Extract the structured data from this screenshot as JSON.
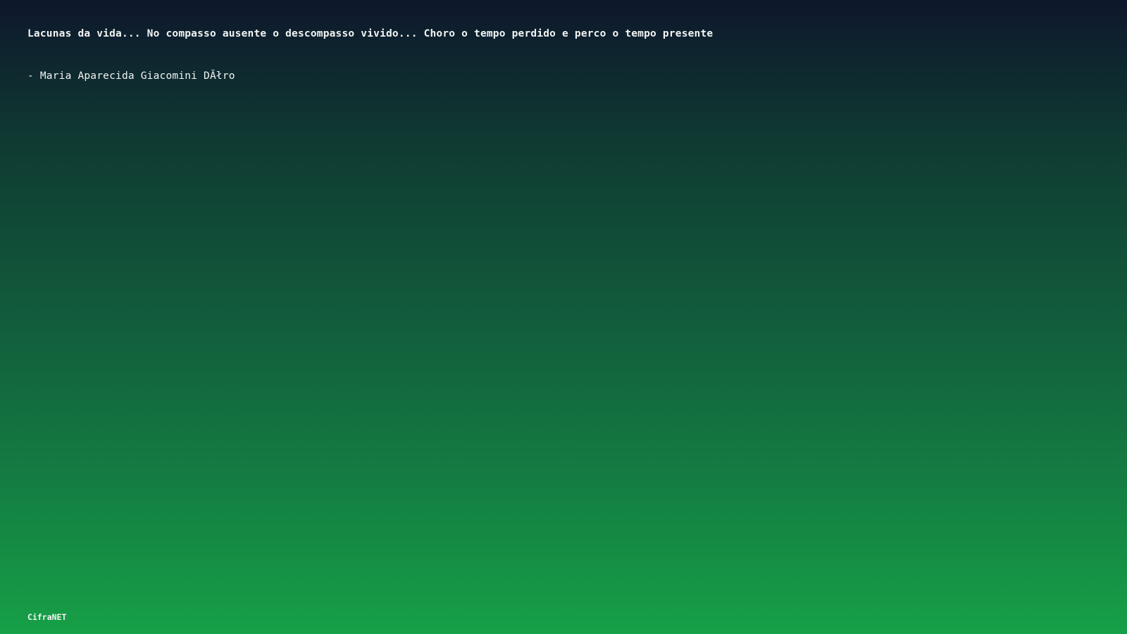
{
  "quote": {
    "text": "Lacunas da vida... No compasso ausente o descompasso vivido... Choro o tempo perdido e perco o tempo presente",
    "author": "- Maria Aparecida Giacomini DĂłro"
  },
  "footer": {
    "brand": "CifraNET"
  },
  "colors": {
    "gradient_top": "#0e172c",
    "gradient_bottom": "#16a047",
    "text": "#f2f5f3"
  }
}
